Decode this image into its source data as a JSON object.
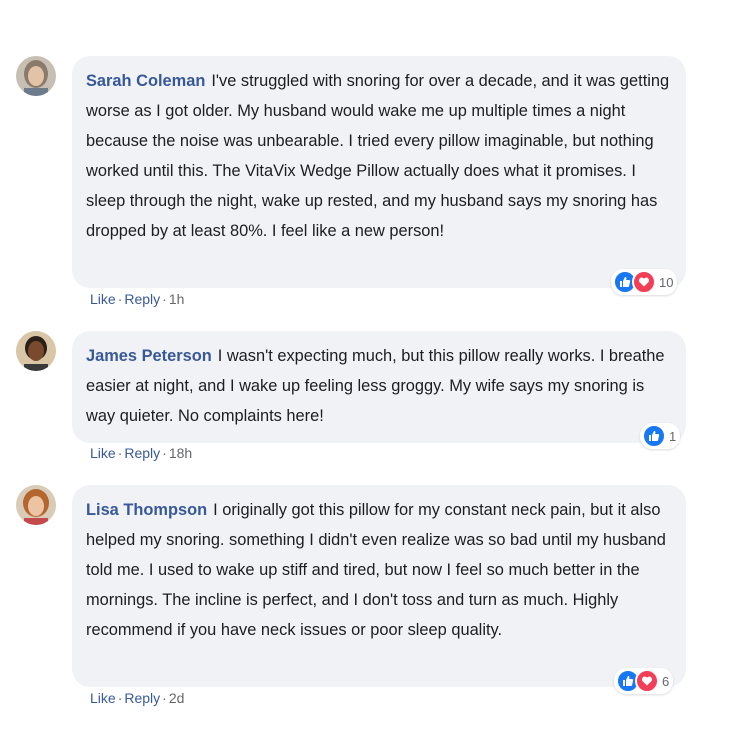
{
  "comments": [
    {
      "author": "Sarah Coleman",
      "text": "I've struggled with snoring for over a decade, and it was getting worse as I got older. My husband would wake me up multiple times a night because the noise was unbearable. I tried every pillow imaginable, but nothing worked until this. The VitaVix Wedge Pillow actually does what it promises. I sleep through the night, wake up rested, and my husband says my snoring has dropped by at least 80%. I feel like a new person!",
      "reaction_count": "10",
      "like_label": "Like",
      "reply_label": "Reply",
      "time": "1h",
      "reactions": [
        "like-icon",
        "love-icon"
      ]
    },
    {
      "author": "James Peterson",
      "text": "I wasn't expecting much, but this pillow really works. I breathe easier at night, and I wake up feeling less groggy. My wife says my snoring is way quieter. No complaints here!",
      "reaction_count": "1",
      "like_label": "Like",
      "reply_label": "Reply",
      "time": "18h",
      "reactions": [
        "like-icon"
      ]
    },
    {
      "author": "Lisa Thompson",
      "text": "I originally got this pillow for my constant neck pain, but it also helped my snoring. something I didn't even realize was so bad until my husband told me. I used to wake up stiff and tired, but now I feel so much better in the mornings. The incline is perfect, and I don't toss and turn as much. Highly recommend if you have neck issues or poor sleep quality.",
      "reaction_count": "6",
      "like_label": "Like",
      "reply_label": "Reply",
      "time": "2d",
      "reactions": [
        "like-icon",
        "love-icon"
      ]
    }
  ],
  "colors": {
    "author_link": "#385898",
    "bubble_bg": "#f0f2f5",
    "like_blue": "#1877f2",
    "love_red": "#f33e58"
  }
}
